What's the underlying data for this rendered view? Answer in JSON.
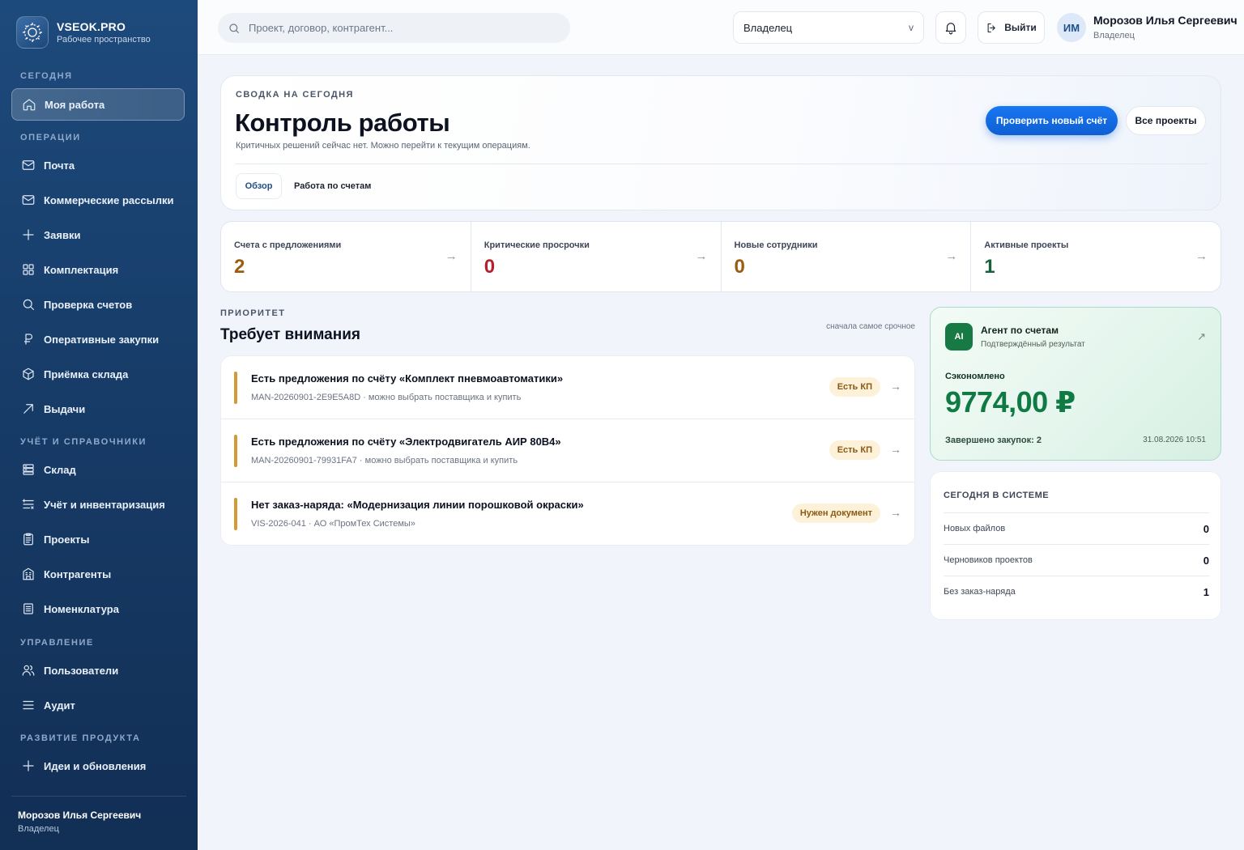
{
  "brand": {
    "name": "VSEOK.PRO",
    "subtitle": "Рабочее пространство"
  },
  "sidebar": {
    "sections": [
      {
        "title": "СЕГОДНЯ"
      },
      {
        "title": "ОПЕРАЦИИ"
      },
      {
        "title": "УЧЁТ И СПРАВОЧНИКИ"
      },
      {
        "title": "УПРАВЛЕНИЕ"
      },
      {
        "title": "РАЗВИТИЕ ПРОДУКТА"
      }
    ],
    "items": [
      {
        "label": "Моя работа",
        "icon": "home-icon",
        "active": true
      },
      {
        "label": "Почта",
        "icon": "mail-icon"
      },
      {
        "label": "Коммерческие рассылки",
        "icon": "mail-icon"
      },
      {
        "label": "Заявки",
        "icon": "plus-icon"
      },
      {
        "label": "Комплектация",
        "icon": "grid-icon"
      },
      {
        "label": "Проверка счетов",
        "icon": "search-icon"
      },
      {
        "label": "Оперативные закупки",
        "icon": "ruble-icon"
      },
      {
        "label": "Приёмка склада",
        "icon": "box-icon"
      },
      {
        "label": "Выдачи",
        "icon": "arrow-up-right-icon"
      },
      {
        "label": "Склад",
        "icon": "warehouse-icon"
      },
      {
        "label": "Учёт и инвентаризация",
        "icon": "inventory-icon"
      },
      {
        "label": "Проекты",
        "icon": "clipboard-icon"
      },
      {
        "label": "Контрагенты",
        "icon": "building-icon"
      },
      {
        "label": "Номенклатура",
        "icon": "list-icon"
      },
      {
        "label": "Пользователи",
        "icon": "users-icon"
      },
      {
        "label": "Аудит",
        "icon": "menu-icon"
      },
      {
        "label": "Идеи и обновления",
        "icon": "plus-icon"
      }
    ],
    "user": {
      "name": "Морозов Илья Сергеевич",
      "role": "Владелец"
    }
  },
  "topbar": {
    "search_placeholder": "Проект, договор, контрагент...",
    "role_value": "Владелец",
    "role_chevron": "v",
    "logout_label": "Выйти",
    "avatar_initials": "ИМ",
    "user_name": "Морозов Илья Сергеевич",
    "user_role": "Владелец"
  },
  "hero": {
    "kicker": "СВОДКА НА СЕГОДНЯ",
    "title": "Контроль работы",
    "subtitle": "Критичных решений сейчас нет. Можно перейти к текущим операциям.",
    "primary_button": "Проверить новый счёт",
    "secondary_button": "Все проекты",
    "tabs": [
      {
        "label": "Обзор",
        "active": true
      },
      {
        "label": "Работа по счетам",
        "active": false
      }
    ]
  },
  "stats": [
    {
      "label": "Счета с предложениями",
      "value": "2",
      "color": "#9a5d10",
      "arrow": "→"
    },
    {
      "label": "Критические просрочки",
      "value": "0",
      "color": "#b3212f",
      "arrow": "→"
    },
    {
      "label": "Новые сотрудники",
      "value": "0",
      "color": "#9a5d10",
      "arrow": "→"
    },
    {
      "label": "Активные проекты",
      "value": "1",
      "color": "#17613f",
      "arrow": "→"
    }
  ],
  "priority": {
    "kicker": "ПРИОРИТЕТ",
    "title": "Требует внимания",
    "sort_label": "сначала самое срочное",
    "items": [
      {
        "title": "Есть предложения по счёту «Комплект пневмоавтоматики»",
        "meta": "MAN-20260901-2E9E5A8D · можно выбрать поставщика и купить",
        "badge": "Есть КП",
        "arrow": "→"
      },
      {
        "title": "Есть предложения по счёту «Электродвигатель АИР 80В4»",
        "meta": "MAN-20260901-79931FA7 · можно выбрать поставщика и купить",
        "badge": "Есть КП",
        "arrow": "→"
      },
      {
        "title": "Нет заказ-наряда: «Модернизация линии порошковой окраски»",
        "meta": "VIS-2026-041 · АО «ПромТех Системы»",
        "badge": "Нужен документ",
        "arrow": "→"
      }
    ]
  },
  "agent": {
    "icon_label": "AI",
    "name": "Агент по счетам",
    "subtitle": "Подтверждённый результат",
    "link_glyph": "↗",
    "saved_label": "Сэкономлено",
    "saved_value": "9774,00 ₽",
    "completed": "Завершено закупок: 2",
    "date": "31.08.2026 10:51"
  },
  "system_today": {
    "title": "СЕГОДНЯ В СИСТЕМЕ",
    "rows": [
      {
        "label": "Новых файлов",
        "value": "0"
      },
      {
        "label": "Черновиков проектов",
        "value": "0"
      },
      {
        "label": "Без заказ-наряда",
        "value": "1"
      }
    ]
  },
  "colors": {
    "sidebar": "#173c68",
    "primary": "#1877f2",
    "accent_warning": "#d39a36",
    "success": "#0f7a44",
    "danger": "#b3212f"
  }
}
